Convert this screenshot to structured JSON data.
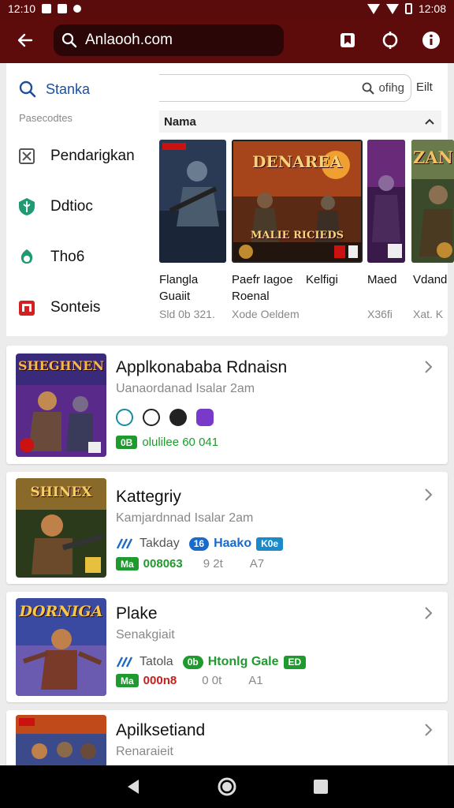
{
  "status_bar": {
    "time_left": "12:10",
    "time_right": "12:08"
  },
  "app_bar": {
    "url": "Anlaooh.com"
  },
  "drawer": {
    "search_label": "Stanka",
    "section_label": "Pasecodtes",
    "items": [
      {
        "label": "Pendarigkan",
        "icon": "box-x-icon"
      },
      {
        "label": "Ddtioc",
        "icon": "shield-leaf-icon"
      },
      {
        "label": "Tho6",
        "icon": "leaf-icon"
      },
      {
        "label": "Sonteis",
        "icon": "gift-icon"
      }
    ]
  },
  "content": {
    "search_text": "ofihg",
    "filter_label": "Eilt",
    "header_label": "Nama",
    "games": [
      {
        "name_lines": [
          "Flangla",
          "Guaiit"
        ],
        "meta": "Sld 0b 321."
      },
      {
        "name_lines": [
          "Paefr Iagoe",
          "Roenal"
        ],
        "meta": "Xode Oeldem",
        "art_title": "DENAREA",
        "art_sub": "MALIE RICIEDS"
      },
      {
        "name_lines": [
          "Kelfigi"
        ],
        "meta": ""
      },
      {
        "name_lines": [
          "Maed"
        ],
        "meta": "X36fi"
      },
      {
        "name_lines": [
          "Vdand"
        ],
        "meta": "Xat. K",
        "art_title": "ZANI"
      }
    ]
  },
  "list": [
    {
      "title": "Applkonababa Rdnaisn",
      "subtitle": "Uanaordanad Isalar 2am",
      "art_title": "SHEGHNEN",
      "badge": "0B",
      "stat": "olulilee 60 041"
    },
    {
      "title": "Kattegriy",
      "subtitle": "Kamjardnnad Isalar 2am",
      "art_title": "SHINEX",
      "tag": "Takday",
      "pill1": "16",
      "tag2": "Haako",
      "pill2": "K0e",
      "badge": "Ma",
      "stat": "008063",
      "stat_a": "9 2t",
      "stat_b": "A7"
    },
    {
      "title": "Plake",
      "subtitle": "Senakgiait",
      "art_title": "DORNIGA",
      "tag": "Tatola",
      "pill1": "0b",
      "tag2": "Htonlg Gale",
      "pill2": "ED",
      "badge": "Ma",
      "stat": "000n8",
      "stat_a": "0 0t",
      "stat_b": "A1"
    },
    {
      "title": "Apilksetiand",
      "subtitle": "Renaraieit"
    }
  ],
  "colors": {
    "appbar": "#5d0b0b",
    "status": "#5a0c0c",
    "accent_blue": "#1d4fa0",
    "green": "#1f9a2e",
    "red": "#c91d1d"
  }
}
